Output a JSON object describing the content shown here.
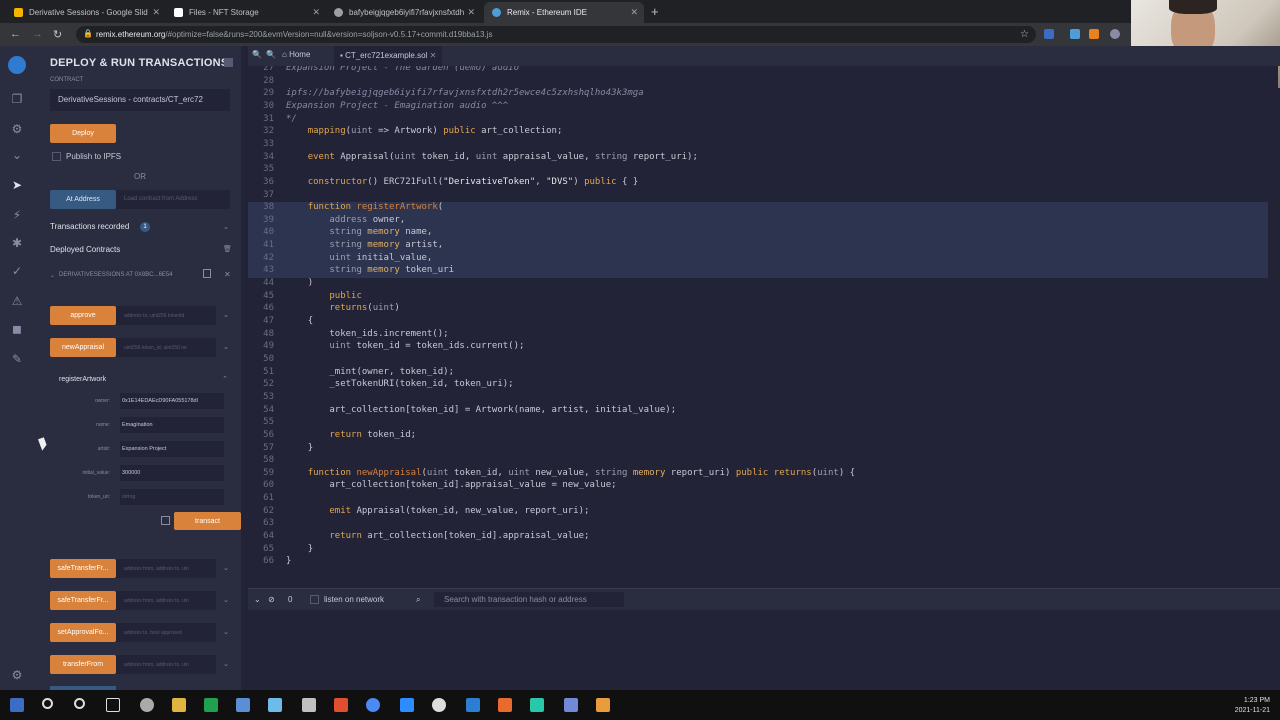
{
  "browser": {
    "tabs": [
      {
        "title": "Derivative Sessions - Google Slid",
        "color": "#f4b400"
      },
      {
        "title": "Files - NFT Storage",
        "color": "#ffffff"
      },
      {
        "title": "bafybeigjqgeb6iyifi7rfavjxnsfxtdh",
        "color": "#9aa0a6"
      },
      {
        "title": "Remix - Ethereum IDE",
        "color": "#4f9dd8"
      }
    ],
    "new_tab": "+",
    "url_host": "remix.ethereum.org",
    "url_rest": "/#optimize=false&runs=200&evmVersion=null&version=soljson-v0.5.17+commit.d19bba13.js"
  },
  "panel": {
    "title": "DEPLOY & RUN TRANSACTIONS",
    "contract_label": "CONTRACT",
    "contract_value": "DerivativeSessions - contracts/CT_erc72",
    "deploy_label": "Deploy",
    "publish_label": "Publish to IPFS",
    "or_label": "OR",
    "at_address_label": "At Address",
    "load_placeholder": "Load contract from Address",
    "transactions_label": "Transactions recorded",
    "transactions_count": "1",
    "deployed_label": "Deployed Contracts",
    "instance_label": "DERIVATIVESESSIONS AT 0X8BC...6E54",
    "functions": [
      {
        "label": "approve",
        "placeholder": "address to, uint256 tokenId"
      },
      {
        "label": "newAppraisal",
        "placeholder": "uint256 token_id, uint256 ne"
      }
    ],
    "register": {
      "title": "registerArtwork",
      "fields": [
        {
          "label": "owner:",
          "value": "0x1E14EDAEcD90FA055178dl",
          "placeholder": false
        },
        {
          "label": "name:",
          "value": "Emagination",
          "placeholder": false
        },
        {
          "label": "artist:",
          "value": "Expansion Project",
          "placeholder": false
        },
        {
          "label": "initial_value:",
          "value": "300000",
          "placeholder": false
        },
        {
          "label": "token_uri:",
          "value": "string",
          "placeholder": true
        }
      ],
      "transact_label": "transact"
    },
    "more_functions": [
      {
        "label": "safeTransferFr...",
        "placeholder": "address from, address to, uin"
      },
      {
        "label": "safeTransferFr...",
        "placeholder": "address from, address to, uin"
      },
      {
        "label": "setApprovalFo...",
        "placeholder": "address to, bool approved"
      },
      {
        "label": "transferFrom",
        "placeholder": "address from, address to, uin"
      }
    ]
  },
  "editor": {
    "tabs": [
      {
        "label": "Home"
      },
      {
        "label": "CT_erc721example.sol"
      }
    ],
    "lines": [
      {
        "n": "27",
        "html": "<span class='c'>Expansion Project - The Garden (demo) audio ^^^</span>"
      },
      {
        "n": "28",
        "html": ""
      },
      {
        "n": "29",
        "html": "<span class='c'>ipfs://bafybeigjqgeb6iyifi7rfavjxnsfxtdh2r5ewce4c5zxhshqlho43k3mga</span>"
      },
      {
        "n": "30",
        "html": "<span class='c'>Expansion Project - Emagination audio ^^^</span>"
      },
      {
        "n": "31",
        "html": "<span class='c'>*/</span>"
      },
      {
        "n": "32",
        "html": "    <span class='k'>mapping</span><span class='n'>(</span><span class='t'>uint</span> <span class='n'>=&gt; Artwork) </span><span class='k'>public</span><span class='n'> art_collection;</span>"
      },
      {
        "n": "33",
        "html": ""
      },
      {
        "n": "34",
        "html": "    <span class='k'>event</span><span class='n'> Appraisal(</span><span class='t'>uint</span><span class='n'> token_id, </span><span class='t'>uint</span><span class='n'> appraisal_value, </span><span class='t'>string</span><span class='n'> report_uri);</span>"
      },
      {
        "n": "35",
        "html": ""
      },
      {
        "n": "36",
        "html": "    <span class='k'>constructor</span><span class='n'>() ERC721Full(</span><span class='s'>\"DerivativeToken\"</span><span class='n'>, </span><span class='s'>\"DVS\"</span><span class='n'>) </span><span class='k'>public</span><span class='n'> { }</span>"
      },
      {
        "n": "37",
        "html": ""
      },
      {
        "n": "38",
        "html": "    <span class='k'>function</span> <span class='f'>registerArtwork</span><span class='n'>(</span>"
      },
      {
        "n": "39",
        "html": "        <span class='t'>address</span><span class='n'> owner,</span>"
      },
      {
        "n": "40",
        "html": "        <span class='t'>string</span> <span class='kw'>memory</span><span class='n'> name,</span>"
      },
      {
        "n": "41",
        "html": "        <span class='t'>string</span> <span class='kw'>memory</span><span class='n'> artist,</span>"
      },
      {
        "n": "42",
        "html": "        <span class='t'>uint</span><span class='n'> initial_value,</span>"
      },
      {
        "n": "43",
        "html": "        <span class='t'>string</span> <span class='kw'>memory</span><span class='n'> token_uri</span>"
      },
      {
        "n": "44",
        "html": "    <span class='n'>)</span>"
      },
      {
        "n": "45",
        "html": "        <span class='k'>public</span>"
      },
      {
        "n": "46",
        "html": "        <span class='k'>returns</span><span class='n'>(</span><span class='t'>uint</span><span class='n'>)</span>"
      },
      {
        "n": "47",
        "html": "    <span class='n'>{</span>"
      },
      {
        "n": "48",
        "html": "        <span class='n'>token_ids.increment();</span>"
      },
      {
        "n": "49",
        "html": "        <span class='t'>uint</span><span class='n'> token_id = token_ids.current();</span>"
      },
      {
        "n": "50",
        "html": ""
      },
      {
        "n": "51",
        "html": "        <span class='n'>_mint(owner, token_id);</span>"
      },
      {
        "n": "52",
        "html": "        <span class='n'>_setTokenURI(token_id, token_uri);</span>"
      },
      {
        "n": "53",
        "html": ""
      },
      {
        "n": "54",
        "html": "        <span class='n'>art_collection[token_id] = Artwork(name, artist, initial_value);</span>"
      },
      {
        "n": "55",
        "html": ""
      },
      {
        "n": "56",
        "html": "        <span class='k'>return</span><span class='n'> token_id;</span>"
      },
      {
        "n": "57",
        "html": "    <span class='n'>}</span>"
      },
      {
        "n": "58",
        "html": ""
      },
      {
        "n": "59",
        "html": "    <span class='k'>function</span> <span class='f'>newAppraisal</span><span class='n'>(</span><span class='t'>uint</span><span class='n'> token_id, </span><span class='t'>uint</span><span class='n'> new_value, </span><span class='t'>string</span> <span class='kw'>memory</span><span class='n'> report_uri) </span><span class='k'>public returns</span><span class='n'>(</span><span class='t'>uint</span><span class='n'>) {</span>"
      },
      {
        "n": "60",
        "html": "        <span class='n'>art_collection[token_id].appraisal_value = new_value;</span>"
      },
      {
        "n": "61",
        "html": ""
      },
      {
        "n": "62",
        "html": "        <span class='k'>emit</span><span class='n'> Appraisal(token_id, new_value, report_uri);</span>"
      },
      {
        "n": "63",
        "html": ""
      },
      {
        "n": "64",
        "html": "        <span class='k'>return</span><span class='n'> art_collection[token_id].appraisal_value;</span>"
      },
      {
        "n": "65",
        "html": "    <span class='n'>}</span>"
      },
      {
        "n": "66",
        "html": "<span class='n'>}</span>"
      }
    ]
  },
  "terminal": {
    "count": "0",
    "listen_label": "listen on network",
    "search_placeholder": "Search with transaction hash or address"
  },
  "taskbar": {
    "time": "1:23 PM",
    "date": "2021-11-21"
  }
}
